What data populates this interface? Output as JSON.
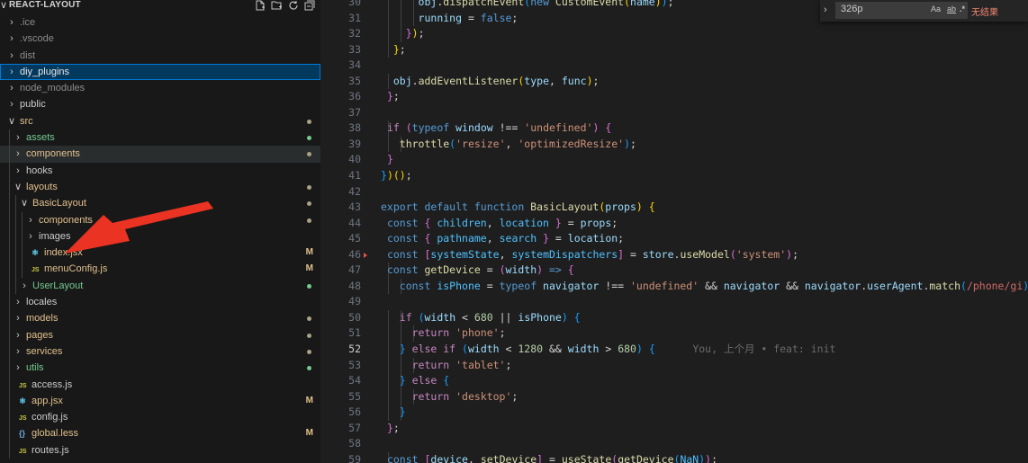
{
  "explorer": {
    "title": "REACT-LAYOUT",
    "actions": [
      "new-file-icon",
      "new-folder-icon",
      "refresh-icon",
      "collapse-all-icon"
    ],
    "tree": [
      {
        "label": ".ice",
        "kind": "folder",
        "depth": 0,
        "open": false,
        "color": "dim"
      },
      {
        "label": ".vscode",
        "kind": "folder",
        "depth": 0,
        "open": false,
        "color": "dim"
      },
      {
        "label": "dist",
        "kind": "folder",
        "depth": 0,
        "open": false,
        "color": "dim"
      },
      {
        "label": "diy_plugins",
        "kind": "folder",
        "depth": 0,
        "open": false,
        "color": "white",
        "selected": true
      },
      {
        "label": "node_modules",
        "kind": "folder",
        "depth": 0,
        "open": false,
        "color": "dim"
      },
      {
        "label": "public",
        "kind": "folder",
        "depth": 0,
        "open": false,
        "color": "norm"
      },
      {
        "label": "src",
        "kind": "folder",
        "depth": 0,
        "open": true,
        "color": "yellow",
        "dot": "#a9a185"
      },
      {
        "label": "assets",
        "kind": "folder",
        "depth": 1,
        "open": false,
        "color": "green",
        "dot": "#73c991"
      },
      {
        "label": "components",
        "kind": "folder",
        "depth": 1,
        "open": false,
        "color": "yellow",
        "dot": "#a9a185",
        "hover": true
      },
      {
        "label": "hooks",
        "kind": "folder",
        "depth": 1,
        "open": false,
        "color": "norm"
      },
      {
        "label": "layouts",
        "kind": "folder",
        "depth": 1,
        "open": true,
        "color": "yellow",
        "dot": "#a9a185"
      },
      {
        "label": "BasicLayout",
        "kind": "folder",
        "depth": 2,
        "open": true,
        "color": "yellow",
        "dot": "#a9a185"
      },
      {
        "label": "components",
        "kind": "folder",
        "depth": 3,
        "open": false,
        "color": "yellow",
        "dot": "#a9a185"
      },
      {
        "label": "images",
        "kind": "folder",
        "depth": 3,
        "open": false,
        "color": "norm"
      },
      {
        "label": "index.jsx",
        "kind": "jsx",
        "depth": 3,
        "color": "yellow",
        "decoration": "M"
      },
      {
        "label": "menuConfig.js",
        "kind": "js",
        "depth": 3,
        "color": "yellow",
        "decoration": "M"
      },
      {
        "label": "UserLayout",
        "kind": "folder",
        "depth": 2,
        "open": false,
        "color": "green",
        "dot": "#73c991"
      },
      {
        "label": "locales",
        "kind": "folder",
        "depth": 1,
        "open": false,
        "color": "norm"
      },
      {
        "label": "models",
        "kind": "folder",
        "depth": 1,
        "open": false,
        "color": "yellow",
        "dot": "#a9a185"
      },
      {
        "label": "pages",
        "kind": "folder",
        "depth": 1,
        "open": false,
        "color": "yellow",
        "dot": "#a9a185"
      },
      {
        "label": "services",
        "kind": "folder",
        "depth": 1,
        "open": false,
        "color": "yellow",
        "dot": "#a9a185"
      },
      {
        "label": "utils",
        "kind": "folder",
        "depth": 1,
        "open": false,
        "color": "green",
        "dot": "#73c991"
      },
      {
        "label": "access.js",
        "kind": "js",
        "depth": 1,
        "color": "norm"
      },
      {
        "label": "app.jsx",
        "kind": "jsx",
        "depth": 1,
        "color": "yellow",
        "decoration": "M"
      },
      {
        "label": "config.js",
        "kind": "js",
        "depth": 1,
        "color": "norm"
      },
      {
        "label": "global.less",
        "kind": "less",
        "depth": 1,
        "color": "yellow",
        "decoration": "M"
      },
      {
        "label": "routes.js",
        "kind": "js",
        "depth": 1,
        "color": "norm"
      }
    ]
  },
  "find": {
    "query": "326p",
    "opt_case": "Aa",
    "opt_word": "ab",
    "opt_regex": ".*",
    "no_results": "无结果"
  },
  "editor": {
    "current_line": 52,
    "lines": [
      {
        "n": 30,
        "tokens": [
          [
            "",
            "      "
          ],
          [
            "vr",
            "obj"
          ],
          [
            "pn",
            "."
          ],
          [
            "fn",
            "dispatchEvent"
          ],
          [
            "b3",
            "("
          ],
          [
            "kw",
            "new "
          ],
          [
            "fn",
            "CustomEvent"
          ],
          [
            "b1",
            "("
          ],
          [
            "vr",
            "name"
          ],
          [
            "b1",
            ")"
          ],
          [
            "b3",
            ")"
          ],
          [
            "pn",
            ";"
          ]
        ]
      },
      {
        "n": 31,
        "tokens": [
          [
            "",
            "      "
          ],
          [
            "vr",
            "running"
          ],
          [
            "pn",
            " = "
          ],
          [
            "kw",
            "false"
          ],
          [
            "pn",
            ";"
          ]
        ]
      },
      {
        "n": 32,
        "tokens": [
          [
            "",
            "    "
          ],
          [
            "b2",
            "}"
          ],
          [
            "b1",
            ")"
          ],
          [
            "pn",
            ";"
          ]
        ]
      },
      {
        "n": 33,
        "tokens": [
          [
            "",
            "  "
          ],
          [
            "b1",
            "}"
          ],
          [
            "pn",
            ";"
          ]
        ]
      },
      {
        "n": 34,
        "tokens": []
      },
      {
        "n": 35,
        "tokens": [
          [
            "",
            "  "
          ],
          [
            "vr",
            "obj"
          ],
          [
            "pn",
            "."
          ],
          [
            "fn",
            "addEventListener"
          ],
          [
            "b1",
            "("
          ],
          [
            "vr",
            "type"
          ],
          [
            "pn",
            ", "
          ],
          [
            "vr",
            "func"
          ],
          [
            "b1",
            ")"
          ],
          [
            "pn",
            ";"
          ]
        ]
      },
      {
        "n": 36,
        "tokens": [
          [
            "",
            " "
          ],
          [
            "b2",
            "}"
          ],
          [
            "pn",
            ";"
          ]
        ]
      },
      {
        "n": 37,
        "tokens": []
      },
      {
        "n": 38,
        "tokens": [
          [
            "",
            " "
          ],
          [
            "ctl",
            "if "
          ],
          [
            "b2",
            "("
          ],
          [
            "kw",
            "typeof "
          ],
          [
            "vr",
            "window"
          ],
          [
            "pn",
            " !== "
          ],
          [
            "str",
            "'undefined'"
          ],
          [
            "b2",
            ")"
          ],
          [
            "pn",
            " "
          ],
          [
            "b2",
            "{"
          ]
        ]
      },
      {
        "n": 39,
        "tokens": [
          [
            "",
            "   "
          ],
          [
            "fn",
            "throttle"
          ],
          [
            "b3",
            "("
          ],
          [
            "str",
            "'resize'"
          ],
          [
            "pn",
            ", "
          ],
          [
            "str",
            "'optimizedResize'"
          ],
          [
            "b3",
            ")"
          ],
          [
            "pn",
            ";"
          ]
        ]
      },
      {
        "n": 40,
        "tokens": [
          [
            "",
            " "
          ],
          [
            "b2",
            "}"
          ]
        ]
      },
      {
        "n": 41,
        "tokens": [
          [
            "b3",
            "}"
          ],
          [
            "b1",
            ")"
          ],
          [
            "b1",
            "()"
          ],
          [
            "pn",
            ";"
          ]
        ]
      },
      {
        "n": 42,
        "tokens": []
      },
      {
        "n": 43,
        "tokens": [
          [
            "kw",
            "export default function "
          ],
          [
            "fn",
            "BasicLayout"
          ],
          [
            "b1",
            "("
          ],
          [
            "vr",
            "props"
          ],
          [
            "b1",
            ")"
          ],
          [
            "pn",
            " "
          ],
          [
            "b1",
            "{"
          ]
        ]
      },
      {
        "n": 44,
        "tokens": [
          [
            "",
            " "
          ],
          [
            "kw",
            "const "
          ],
          [
            "b2",
            "{ "
          ],
          [
            "cn",
            "children"
          ],
          [
            "pn",
            ", "
          ],
          [
            "cn",
            "location"
          ],
          [
            "b2",
            " }"
          ],
          [
            "pn",
            " = "
          ],
          [
            "vr",
            "props"
          ],
          [
            "pn",
            ";"
          ]
        ]
      },
      {
        "n": 45,
        "tokens": [
          [
            "",
            " "
          ],
          [
            "kw",
            "const "
          ],
          [
            "b2",
            "{ "
          ],
          [
            "cn",
            "pathname"
          ],
          [
            "pn",
            ", "
          ],
          [
            "cn",
            "search"
          ],
          [
            "b2",
            " }"
          ],
          [
            "pn",
            " = "
          ],
          [
            "vr",
            "location"
          ],
          [
            "pn",
            ";"
          ]
        ]
      },
      {
        "n": 46,
        "tokens": [
          [
            "",
            " "
          ],
          [
            "kw",
            "const "
          ],
          [
            "b2",
            "["
          ],
          [
            "cn",
            "systemState"
          ],
          [
            "pn",
            ", "
          ],
          [
            "cn",
            "systemDispatchers"
          ],
          [
            "b2",
            "]"
          ],
          [
            "pn",
            " = "
          ],
          [
            "vr",
            "store"
          ],
          [
            "pn",
            "."
          ],
          [
            "fn",
            "useModel"
          ],
          [
            "b2",
            "("
          ],
          [
            "str",
            "'system'"
          ],
          [
            "b2",
            ")"
          ],
          [
            "pn",
            ";"
          ]
        ],
        "mark": true
      },
      {
        "n": 47,
        "tokens": [
          [
            "",
            " "
          ],
          [
            "kw",
            "const "
          ],
          [
            "fn",
            "getDevice"
          ],
          [
            "pn",
            " = "
          ],
          [
            "b2",
            "("
          ],
          [
            "vr",
            "width"
          ],
          [
            "b2",
            ")"
          ],
          [
            "kw",
            " => "
          ],
          [
            "b2",
            "{"
          ]
        ]
      },
      {
        "n": 48,
        "tokens": [
          [
            "",
            "   "
          ],
          [
            "kw",
            "const "
          ],
          [
            "cn",
            "isPhone"
          ],
          [
            "pn",
            " = "
          ],
          [
            "kw",
            "typeof "
          ],
          [
            "vr",
            "navigator"
          ],
          [
            "pn",
            " !== "
          ],
          [
            "str",
            "'undefined'"
          ],
          [
            "pn",
            " && "
          ],
          [
            "vr",
            "navigator"
          ],
          [
            "pn",
            " && "
          ],
          [
            "vr",
            "navigator"
          ],
          [
            "pn",
            "."
          ],
          [
            "vr",
            "userAgent"
          ],
          [
            "pn",
            "."
          ],
          [
            "fn",
            "match"
          ],
          [
            "b3",
            "("
          ],
          [
            "rx",
            "/phone/gi"
          ],
          [
            "b3",
            ")"
          ],
          [
            "pn",
            ";"
          ]
        ]
      },
      {
        "n": 49,
        "tokens": []
      },
      {
        "n": 50,
        "tokens": [
          [
            "",
            "   "
          ],
          [
            "ctl",
            "if "
          ],
          [
            "b3",
            "("
          ],
          [
            "vr",
            "width"
          ],
          [
            "pn",
            " < "
          ],
          [
            "num",
            "680"
          ],
          [
            "pn",
            " || "
          ],
          [
            "vr",
            "isPhone"
          ],
          [
            "b3",
            ")"
          ],
          [
            "pn",
            " "
          ],
          [
            "b3",
            "{"
          ]
        ]
      },
      {
        "n": 51,
        "tokens": [
          [
            "",
            "     "
          ],
          [
            "ctl",
            "return "
          ],
          [
            "str",
            "'phone'"
          ],
          [
            "pn",
            ";"
          ]
        ]
      },
      {
        "n": 52,
        "tokens": [
          [
            "",
            "   "
          ],
          [
            "b3",
            "}"
          ],
          [
            "ctl",
            " else if "
          ],
          [
            "b3",
            "("
          ],
          [
            "vr",
            "width"
          ],
          [
            "pn",
            " < "
          ],
          [
            "num",
            "1280"
          ],
          [
            "pn",
            " && "
          ],
          [
            "vr",
            "width"
          ],
          [
            "pn",
            " > "
          ],
          [
            "num",
            "680"
          ],
          [
            "b3",
            ")"
          ],
          [
            "pn",
            " "
          ],
          [
            "b3",
            "{"
          ],
          [
            "blame",
            "      You, 上个月 • feat: init"
          ]
        ]
      },
      {
        "n": 53,
        "tokens": [
          [
            "",
            "     "
          ],
          [
            "ctl",
            "return "
          ],
          [
            "str",
            "'tablet'"
          ],
          [
            "pn",
            ";"
          ]
        ]
      },
      {
        "n": 54,
        "tokens": [
          [
            "",
            "   "
          ],
          [
            "b3",
            "}"
          ],
          [
            "ctl",
            " else "
          ],
          [
            "b3",
            "{"
          ]
        ]
      },
      {
        "n": 55,
        "tokens": [
          [
            "",
            "     "
          ],
          [
            "ctl",
            "return "
          ],
          [
            "str",
            "'desktop'"
          ],
          [
            "pn",
            ";"
          ]
        ]
      },
      {
        "n": 56,
        "tokens": [
          [
            "",
            "   "
          ],
          [
            "b3",
            "}"
          ]
        ]
      },
      {
        "n": 57,
        "tokens": [
          [
            "",
            " "
          ],
          [
            "b2",
            "}"
          ],
          [
            "pn",
            ";"
          ]
        ]
      },
      {
        "n": 58,
        "tokens": []
      },
      {
        "n": 59,
        "tokens": [
          [
            "",
            " "
          ],
          [
            "kw",
            "const "
          ],
          [
            "b2",
            "["
          ],
          [
            "vr",
            "device"
          ],
          [
            "pn",
            ", "
          ],
          [
            "fn",
            "setDevice"
          ],
          [
            "b2",
            "]"
          ],
          [
            "pn",
            " = "
          ],
          [
            "fn",
            "useState"
          ],
          [
            "b2",
            "("
          ],
          [
            "fn",
            "getDevice"
          ],
          [
            "b3",
            "("
          ],
          [
            "cn",
            "NaN"
          ],
          [
            "b3",
            ")"
          ],
          [
            "b2",
            ")"
          ],
          [
            "pn",
            ";"
          ]
        ]
      }
    ]
  }
}
